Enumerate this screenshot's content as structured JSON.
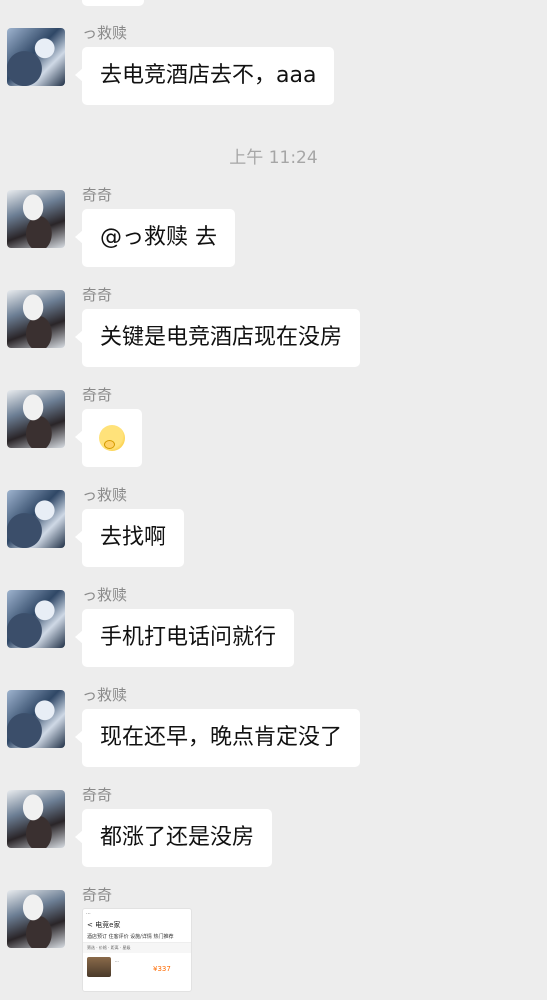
{
  "messages": [
    {
      "sender": "っ救赎",
      "text": "去电竞酒店去不，aaa"
    },
    {
      "sender": "奇奇",
      "text": "@っ救赎 去"
    },
    {
      "sender": "奇奇",
      "text": "关键是电竞酒店现在没房"
    },
    {
      "sender": "奇奇",
      "emoji": "face-emoji"
    },
    {
      "sender": "っ救赎",
      "text": "去找啊"
    },
    {
      "sender": "っ救赎",
      "text": "手机打电话问就行"
    },
    {
      "sender": "っ救赎",
      "text": "现在还早，晚点肯定没了"
    },
    {
      "sender": "奇奇",
      "text": "都涨了还是没房"
    },
    {
      "sender": "奇奇",
      "image": "shared-screenshot"
    }
  ],
  "timestamp": "上午 11:24",
  "shared_screenshot": {
    "status": "...",
    "title": "< 电竞e家",
    "tabs": "酒店预订 住客评价 设施/详情 热门推荐",
    "filters": "筛选 · 价格 · 距离 · 星级",
    "hotel_name": "...",
    "price": "¥337"
  },
  "colors": {
    "background": "#ededed",
    "bubble": "#ffffff",
    "name": "#8a8a8a",
    "time": "#a6a6a6"
  }
}
